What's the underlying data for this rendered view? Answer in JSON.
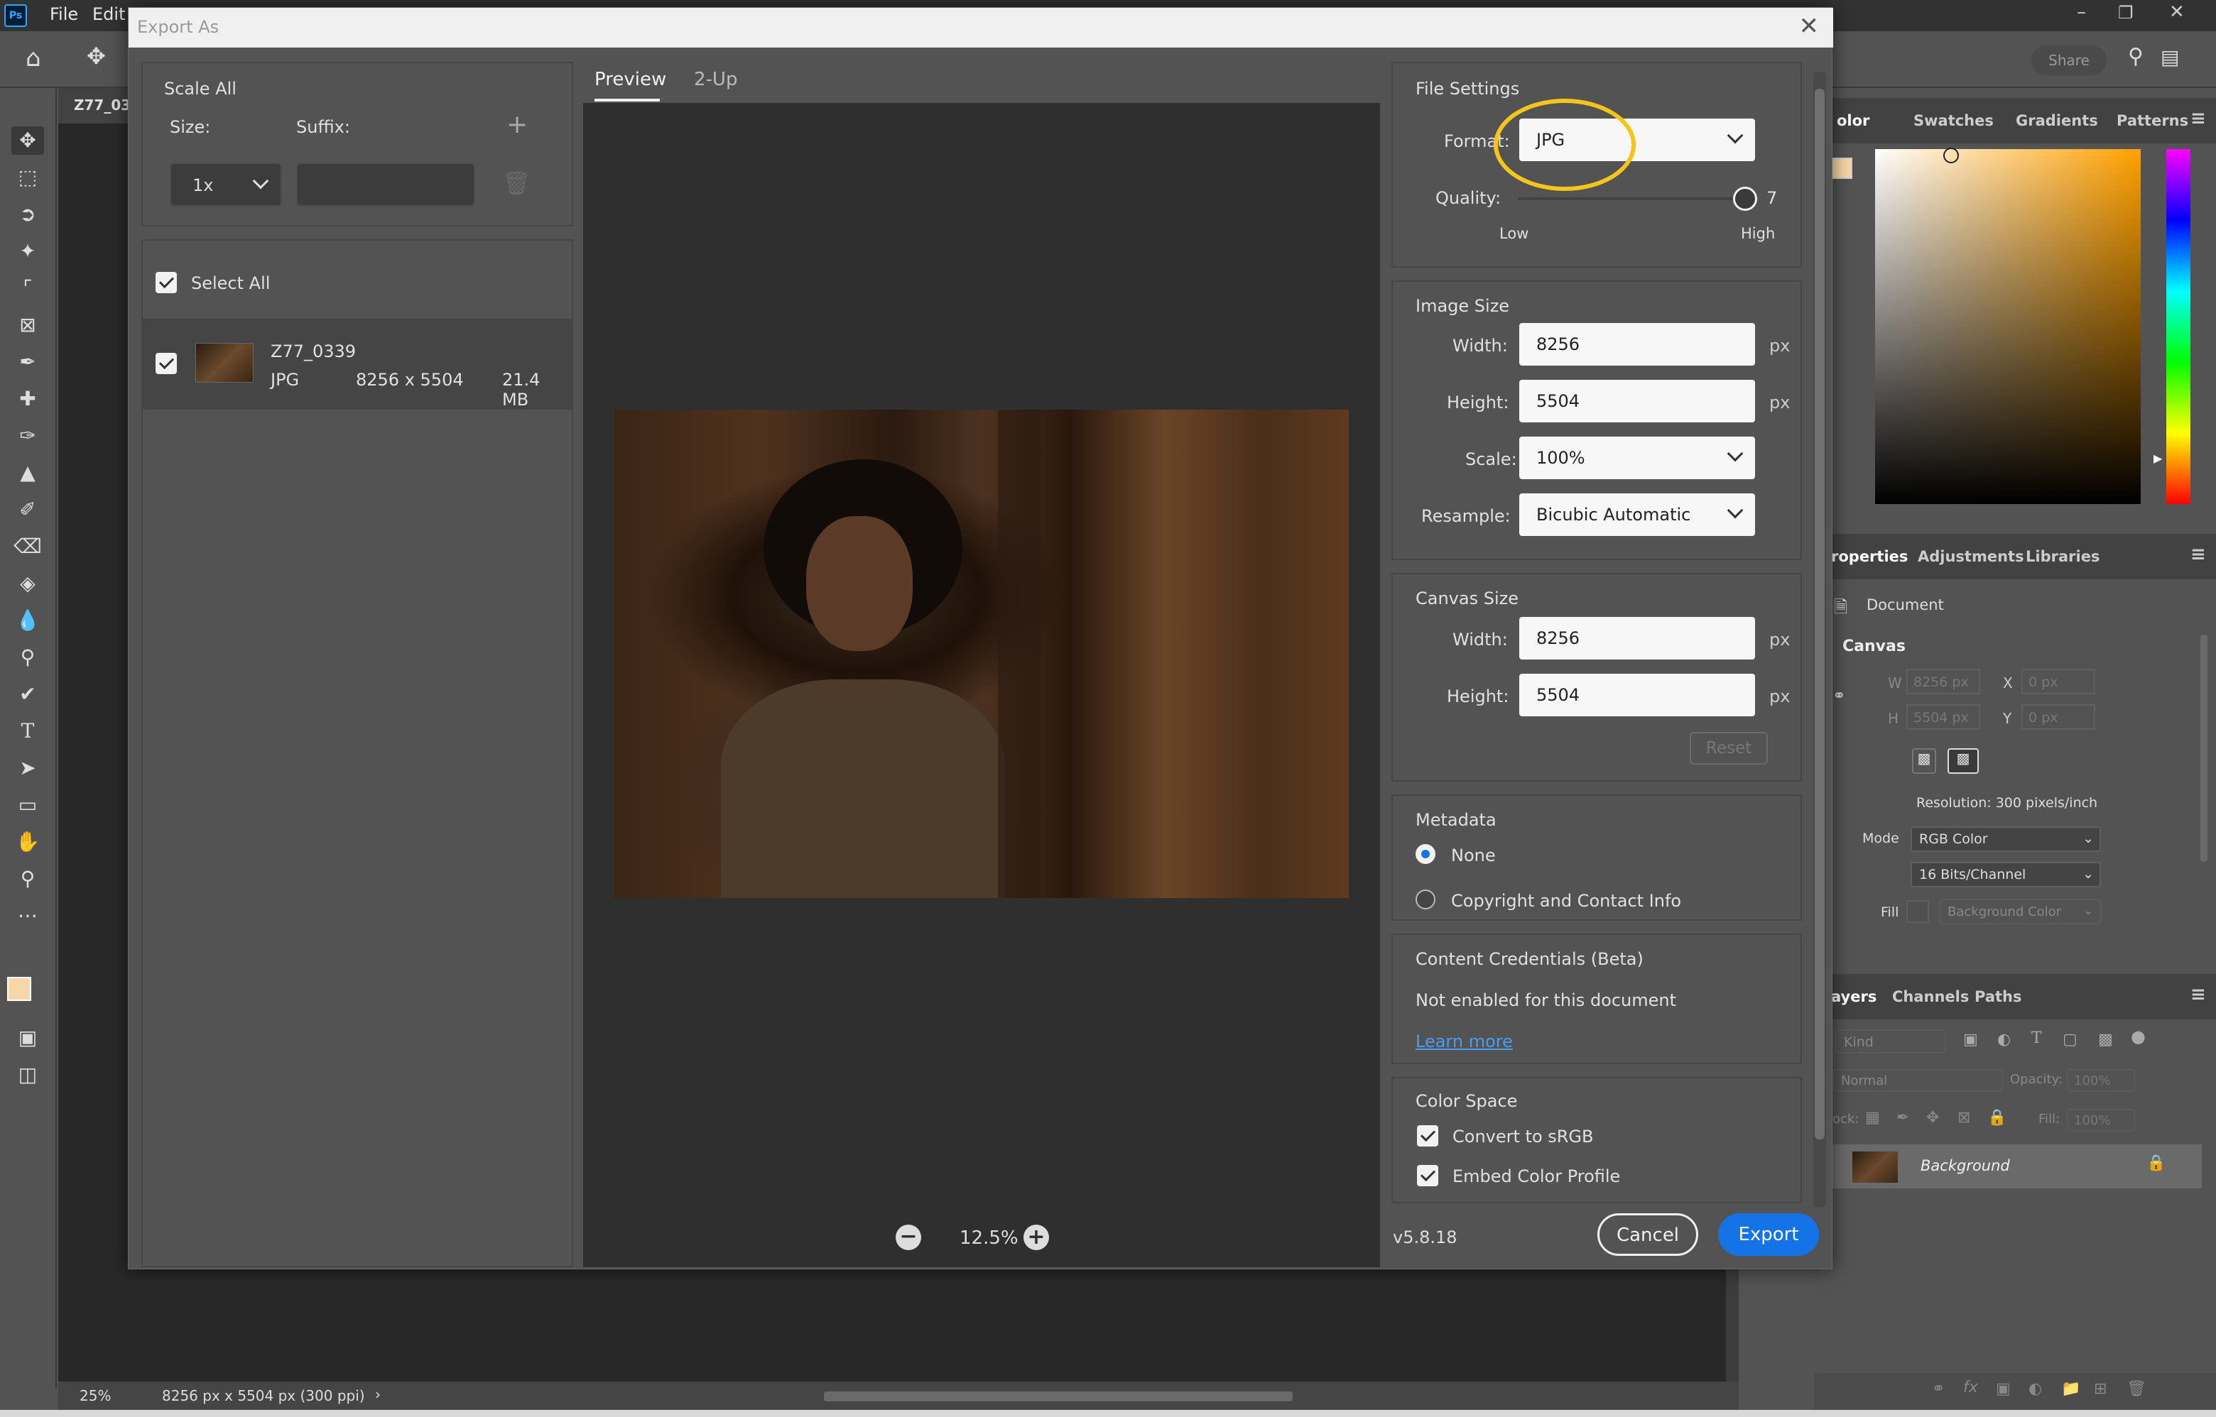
{
  "app": {
    "logo": "Ps",
    "menu": [
      "File",
      "Edit"
    ],
    "doc_tab": "Z77_03",
    "share_label": "Share",
    "status": {
      "zoom": "25%",
      "info": "8256 px x 5504 px (300 ppi)"
    }
  },
  "right_panel": {
    "color_tabs": [
      "olor",
      "Swatches",
      "Gradients",
      "Patterns"
    ],
    "properties_tabs": [
      "roperties",
      "Adjustments",
      "Libraries"
    ],
    "document_label": "Document",
    "canvas_label": "Canvas",
    "w_value": "8256 px",
    "h_value": "5504 px",
    "x_value": "0 px",
    "y_value": "0 px",
    "w_label": "W",
    "h_label": "H",
    "x_label": "X",
    "y_label": "Y",
    "resolution": "Resolution: 300 pixels/inch",
    "mode_label": "Mode",
    "mode_value": "RGB Color",
    "bits_value": "16 Bits/Channel",
    "fill_label": "Fill",
    "fill_value": "Background Color",
    "layers_tabs": [
      "ayers",
      "Channels",
      "Paths"
    ],
    "kind_label": "Kind",
    "blend_mode": "Normal",
    "opacity_label": "Opacity:",
    "opacity_value": "100%",
    "lock_label": "ock:",
    "fill2_label": "Fill:",
    "fill2_value": "100%",
    "layer_name": "Background"
  },
  "dialog": {
    "title": "Export As",
    "scale_all": {
      "title": "Scale All",
      "size_label": "Size:",
      "suffix_label": "Suffix:",
      "size_value": "1x",
      "suffix_value": ""
    },
    "select_all_label": "Select All",
    "file": {
      "name": "Z77_0339",
      "format": "JPG",
      "dimensions": "8256 x 5504",
      "size": "21.4 MB"
    },
    "preview_tabs": [
      "Preview",
      "2-Up"
    ],
    "zoom": "12.5%",
    "file_settings": {
      "title": "File Settings",
      "format_label": "Format:",
      "format_value": "JPG",
      "quality_label": "Quality:",
      "quality_value": "7",
      "quality_fraction": 1.0,
      "low_label": "Low",
      "high_label": "High"
    },
    "image_size": {
      "title": "Image Size",
      "width_label": "Width:",
      "width_value": "8256",
      "height_label": "Height:",
      "height_value": "5504",
      "scale_label": "Scale:",
      "scale_value": "100%",
      "resample_label": "Resample:",
      "resample_value": "Bicubic Automatic",
      "unit": "px"
    },
    "canvas_size": {
      "title": "Canvas Size",
      "width_label": "Width:",
      "width_value": "8256",
      "height_label": "Height:",
      "height_value": "5504",
      "reset_label": "Reset",
      "unit": "px"
    },
    "metadata": {
      "title": "Metadata",
      "options": [
        "None",
        "Copyright and Contact Info"
      ],
      "selected": "None"
    },
    "content_credentials": {
      "title": "Content Credentials (Beta)",
      "text": "Not enabled for this document",
      "link": "Learn more"
    },
    "color_space": {
      "title": "Color Space",
      "convert_label": "Convert to sRGB",
      "embed_label": "Embed Color Profile"
    },
    "version": "v5.8.18",
    "cancel_label": "Cancel",
    "export_label": "Export"
  },
  "colors": {
    "accent": "#1473e6",
    "highlight_circle": "#f5c518",
    "link": "#4a9cf0",
    "foreground_swatch": "#f7d7a8"
  }
}
